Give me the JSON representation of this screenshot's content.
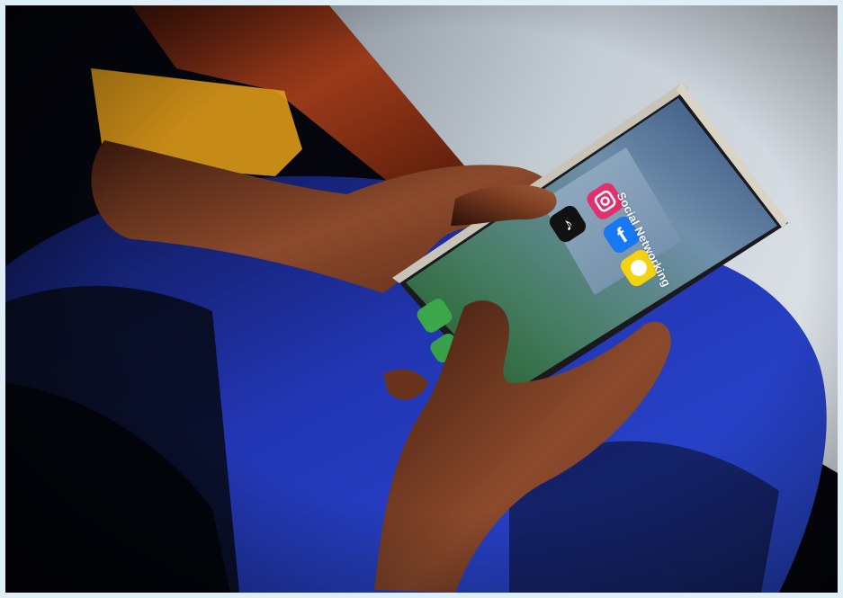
{
  "photo": {
    "subject": "hands holding a smartphone",
    "colors": {
      "shirt": "#2742c8",
      "skin": "#8a4a2e",
      "background_dark": "#05060d",
      "wall": "#b9c3cc"
    }
  },
  "phone_screen": {
    "folder_title": "Social Networking",
    "apps": [
      {
        "icon": "instagram-icon",
        "color": "#e1306c"
      },
      {
        "icon": "tiktok-icon",
        "color": "#111111"
      },
      {
        "icon": "facebook-icon",
        "color": "#1877f2"
      },
      {
        "icon": "snapchat-icon",
        "color": "#f5d20f"
      }
    ]
  }
}
